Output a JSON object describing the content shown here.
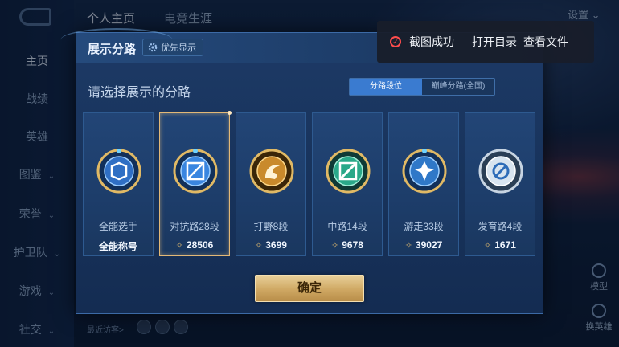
{
  "background": {
    "sidebar": {
      "items": [
        {
          "label": "主页",
          "active": true
        },
        {
          "label": "战绩"
        },
        {
          "label": "英雄"
        },
        {
          "label": "图鉴",
          "chevron": "⌄"
        },
        {
          "label": "荣誉",
          "chevron": "⌄"
        },
        {
          "label": "护卫队",
          "chevron": "⌄"
        },
        {
          "label": "游戏",
          "chevron": "⌄"
        },
        {
          "label": "社交",
          "chevron": "⌄"
        }
      ]
    },
    "tabs": [
      "个人主页",
      "电竞生涯"
    ],
    "settings_label": "设置",
    "visitors_label": "最近访客>",
    "right_side": [
      {
        "label": "模型",
        "icon": "person-icon"
      },
      {
        "label": "换英雄",
        "icon": "swap-icon"
      }
    ]
  },
  "modal": {
    "title": "展示分路",
    "priority_button": "优先显示",
    "prompt": "请选择展示的分路",
    "segment": {
      "left": "分路段位",
      "right": "巅峰分路(全国)",
      "selected": "left"
    },
    "cards": [
      {
        "role": "全能选手",
        "stat": "全能称号",
        "has_score": false,
        "selected": false,
        "emblem": "all-round-emblem-icon",
        "accent": "#2f6fc4"
      },
      {
        "role": "对抗路28段",
        "stat": "28506",
        "has_score": true,
        "selected": true,
        "emblem": "clash-lane-emblem-icon",
        "accent": "#3a86e0"
      },
      {
        "role": "打野8段",
        "stat": "3699",
        "has_score": true,
        "selected": false,
        "emblem": "jungle-emblem-icon",
        "accent": "#c98a2c"
      },
      {
        "role": "中路14段",
        "stat": "9678",
        "has_score": true,
        "selected": false,
        "emblem": "mid-lane-emblem-icon",
        "accent": "#2aa889"
      },
      {
        "role": "游走33段",
        "stat": "39027",
        "has_score": true,
        "selected": false,
        "emblem": "roam-emblem-icon",
        "accent": "#2f78c8"
      },
      {
        "role": "发育路4段",
        "stat": "1671",
        "has_score": true,
        "selected": false,
        "emblem": "farm-lane-emblem-icon",
        "accent": "#9fb3c8"
      }
    ],
    "confirm_label": "确定"
  },
  "toast": {
    "message": "截图成功",
    "open_dir": "打开目录",
    "view_file": "查看文件"
  }
}
